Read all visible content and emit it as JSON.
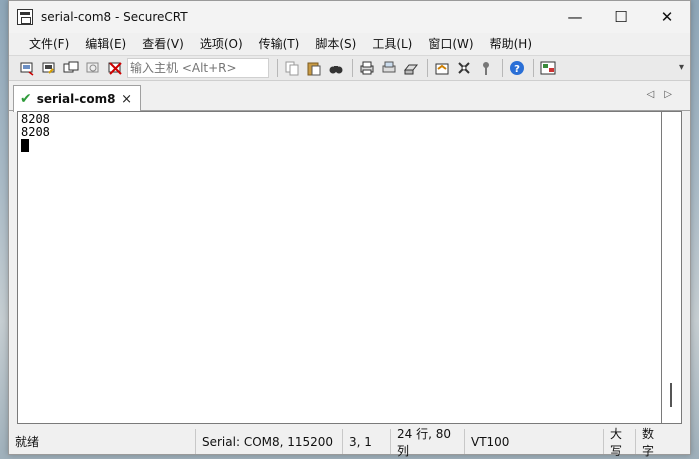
{
  "window": {
    "title": "serial-com8 - SecureCRT",
    "minimize_glyph": "—",
    "maximize_glyph": "☐",
    "close_glyph": "✕"
  },
  "menu": {
    "items": [
      "文件(F)",
      "编辑(E)",
      "查看(V)",
      "选项(O)",
      "传输(T)",
      "脚本(S)",
      "工具(L)",
      "窗口(W)",
      "帮助(H)"
    ]
  },
  "toolbar": {
    "command_placeholder": "输入主机 <Alt+R>",
    "icons_group1": [
      "connect-icon",
      "quick-connect-icon",
      "connect-in-tab-icon",
      "reconnect-icon",
      "disconnect-icon"
    ],
    "icons_group2": [
      "copy-icon",
      "paste-icon",
      "find-icon"
    ],
    "icons_group3": [
      "print-icon",
      "print-selection-icon",
      "printer-setup-icon"
    ],
    "icons_group4": [
      "session-options-icon",
      "global-options-icon",
      "keymap-icon"
    ],
    "icons_group5": [
      "help-icon"
    ],
    "icons_group6": [
      "tile-icon"
    ]
  },
  "tab": {
    "label": "serial-com8",
    "close_glyph": "×",
    "nav_glyphs": "◁▷"
  },
  "terminal": {
    "lines": [
      "8208",
      "8208"
    ]
  },
  "status": {
    "ready": "就绪",
    "connection": "Serial: COM8, 115200",
    "cursor_pos": "3,   1",
    "size": "24 行, 80 列",
    "emulation": "VT100",
    "caps": "大写",
    "num": "数字"
  }
}
